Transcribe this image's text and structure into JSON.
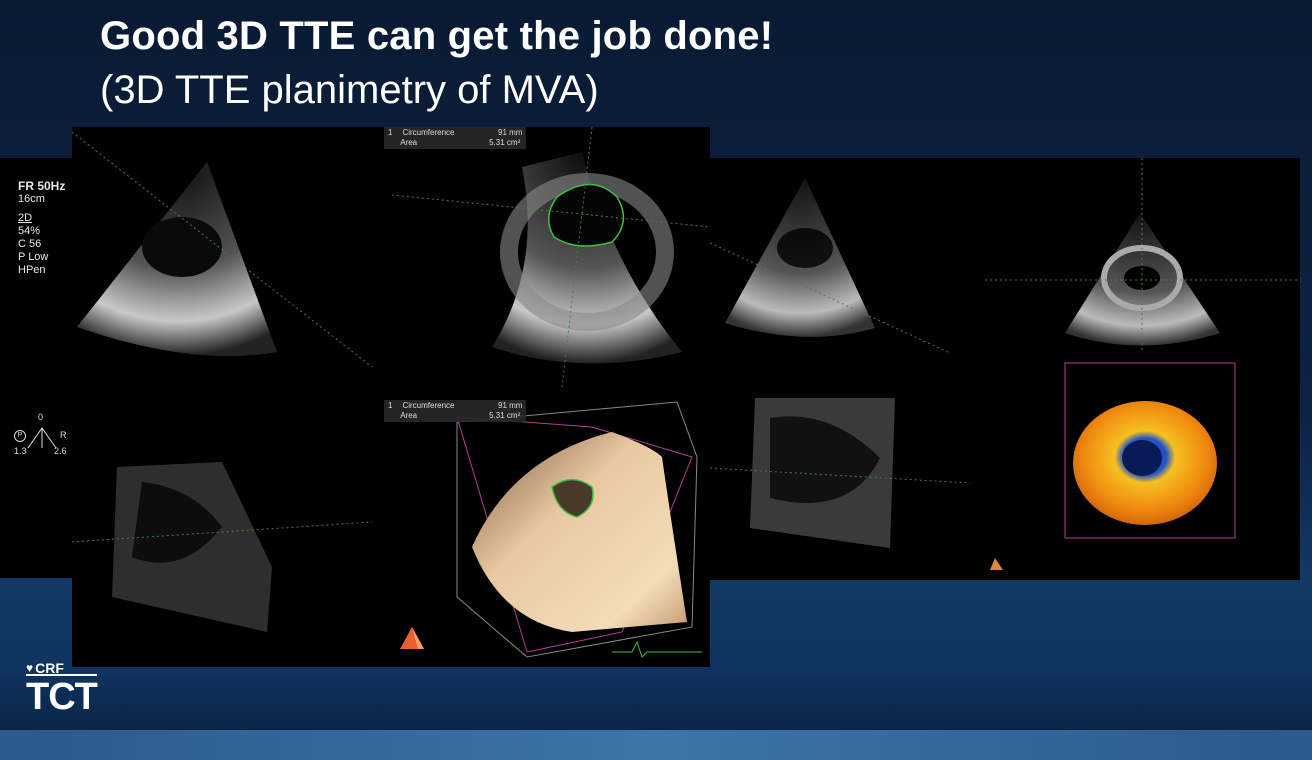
{
  "slide": {
    "title": "Good 3D TTE can get the job done!",
    "subtitle": "(3D TTE planimetry of MVA)"
  },
  "echo_settings": {
    "fr": "FR 50Hz",
    "depth": "16cm",
    "mode": "2D",
    "gain": "54%",
    "compress": "C 56",
    "power": "P Low",
    "harmonics": "HPen"
  },
  "probe_marker": {
    "p": "P",
    "top": "0",
    "r": "R",
    "left_val": "1.3",
    "right_val": "2.6"
  },
  "measurement_1": {
    "index": "1",
    "rows": [
      {
        "label": "Circumference",
        "value": "91 mm"
      },
      {
        "label": "Area",
        "value": "5.31 cm²"
      }
    ]
  },
  "measurement_2": {
    "index": "1",
    "rows": [
      {
        "label": "Circumference",
        "value": "91 mm"
      },
      {
        "label": "Area",
        "value": "5.31 cm²"
      }
    ]
  },
  "logo": {
    "crf": "CRF",
    "tct": "TCT"
  },
  "colors": {
    "background": "#0d2345",
    "band": "#123a63",
    "text": "#ffffff",
    "trace": "#3fbf3f"
  }
}
